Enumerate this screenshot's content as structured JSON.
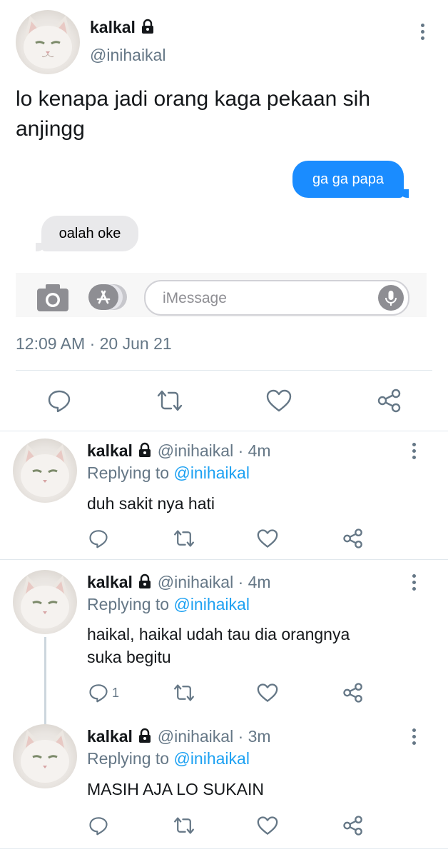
{
  "tweet": {
    "author": "kalkal",
    "handle": "@inihaikal",
    "text_line1": "lo kenapa jadi orang kaga pekaan sih",
    "text_line2": "anjingg",
    "timestamp": "12:09 AM · 20 Jun 21",
    "imessage": {
      "sent": "ga ga papa",
      "received": "oalah oke",
      "input_placeholder": "iMessage"
    }
  },
  "replies": [
    {
      "author": "kalkal",
      "handle": "@inihaikal",
      "time": "· 4m",
      "replying_prefix": "Replying to",
      "replying_to": "@inihaikal",
      "text_line1": "duh sakit nya hati",
      "text_line2": "",
      "reply_count": ""
    },
    {
      "author": "kalkal",
      "handle": "@inihaikal",
      "time": "· 4m",
      "replying_prefix": "Replying to",
      "replying_to": "@inihaikal",
      "text_line1": "haikal, haikal udah tau dia orangnya",
      "text_line2": "suka begitu",
      "reply_count": "1"
    },
    {
      "author": "kalkal",
      "handle": "@inihaikal",
      "time": "· 3m",
      "replying_prefix": "Replying to",
      "replying_to": "@inihaikal",
      "text_line1": "MASIH AJA LO SUKAIN",
      "text_line2": "",
      "reply_count": ""
    }
  ],
  "colors": {
    "link_blue": "#1da1f2",
    "imessage_blue": "#1a8cff",
    "muted": "#657786"
  }
}
